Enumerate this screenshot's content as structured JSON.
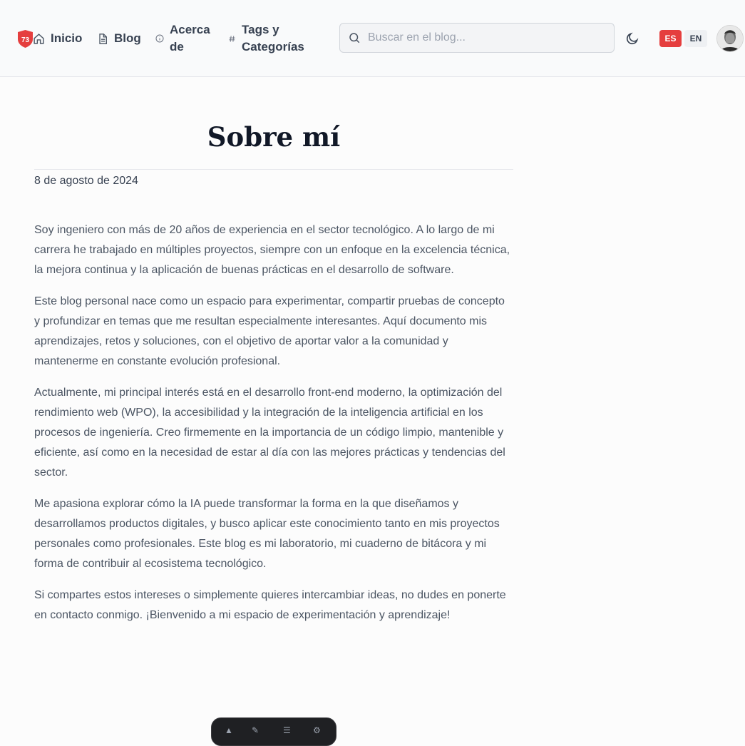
{
  "header": {
    "logo_text": "73",
    "nav": [
      {
        "label": "Inicio",
        "icon": "home-icon"
      },
      {
        "label": "Blog",
        "icon": "document-icon"
      },
      {
        "label": "Acerca de",
        "icon": "info-icon"
      },
      {
        "label": "Tags y Categorías",
        "icon": "hash-icon"
      }
    ],
    "search_placeholder": "Buscar en el blog...",
    "theme_icon": "moon-icon",
    "languages": {
      "es": "ES",
      "en": "EN",
      "active": "ES"
    },
    "colors": {
      "accent": "#e53e3e",
      "header_bg": "#f9fafb",
      "title": "#111827"
    }
  },
  "page": {
    "title": "Sobre mí",
    "date": "8 de agosto de 2024",
    "paragraphs": [
      "Soy ingeniero con más de 20 años de experiencia en el sector tecnológico. A lo largo de mi carrera he trabajado en múltiples proyectos, siempre con un enfoque en la excelencia técnica, la mejora continua y la aplicación de buenas prácticas en el desarrollo de software.",
      "Este blog personal nace como un espacio para experimentar, compartir pruebas de concepto y profundizar en temas que me resultan especialmente interesantes. Aquí documento mis aprendizajes, retos y soluciones, con el objetivo de aportar valor a la comunidad y mantenerme en constante evolución profesional.",
      "Actualmente, mi principal interés está en el desarrollo front-end moderno, la optimización del rendimiento web (WPO), la accesibilidad y la integración de la inteligencia artificial en los procesos de ingeniería. Creo firmemente en la importancia de un código limpio, mantenible y eficiente, así como en la necesidad de estar al día con las mejores prácticas y tendencias del sector.",
      "Me apasiona explorar cómo la IA puede transformar la forma en la que diseñamos y desarrollamos productos digitales, y busco aplicar este conocimiento tanto en mis proyectos personales como profesionales. Este blog es mi laboratorio, mi cuaderno de bitácora y mi forma de contribuir al ecosistema tecnológico.",
      "Si compartes estos intereses o simplemente quieres intercambiar ideas, no dudes en ponerte en contacto conmigo. ¡Bienvenido a mi espacio de experimentación y aprendizaje!"
    ]
  }
}
